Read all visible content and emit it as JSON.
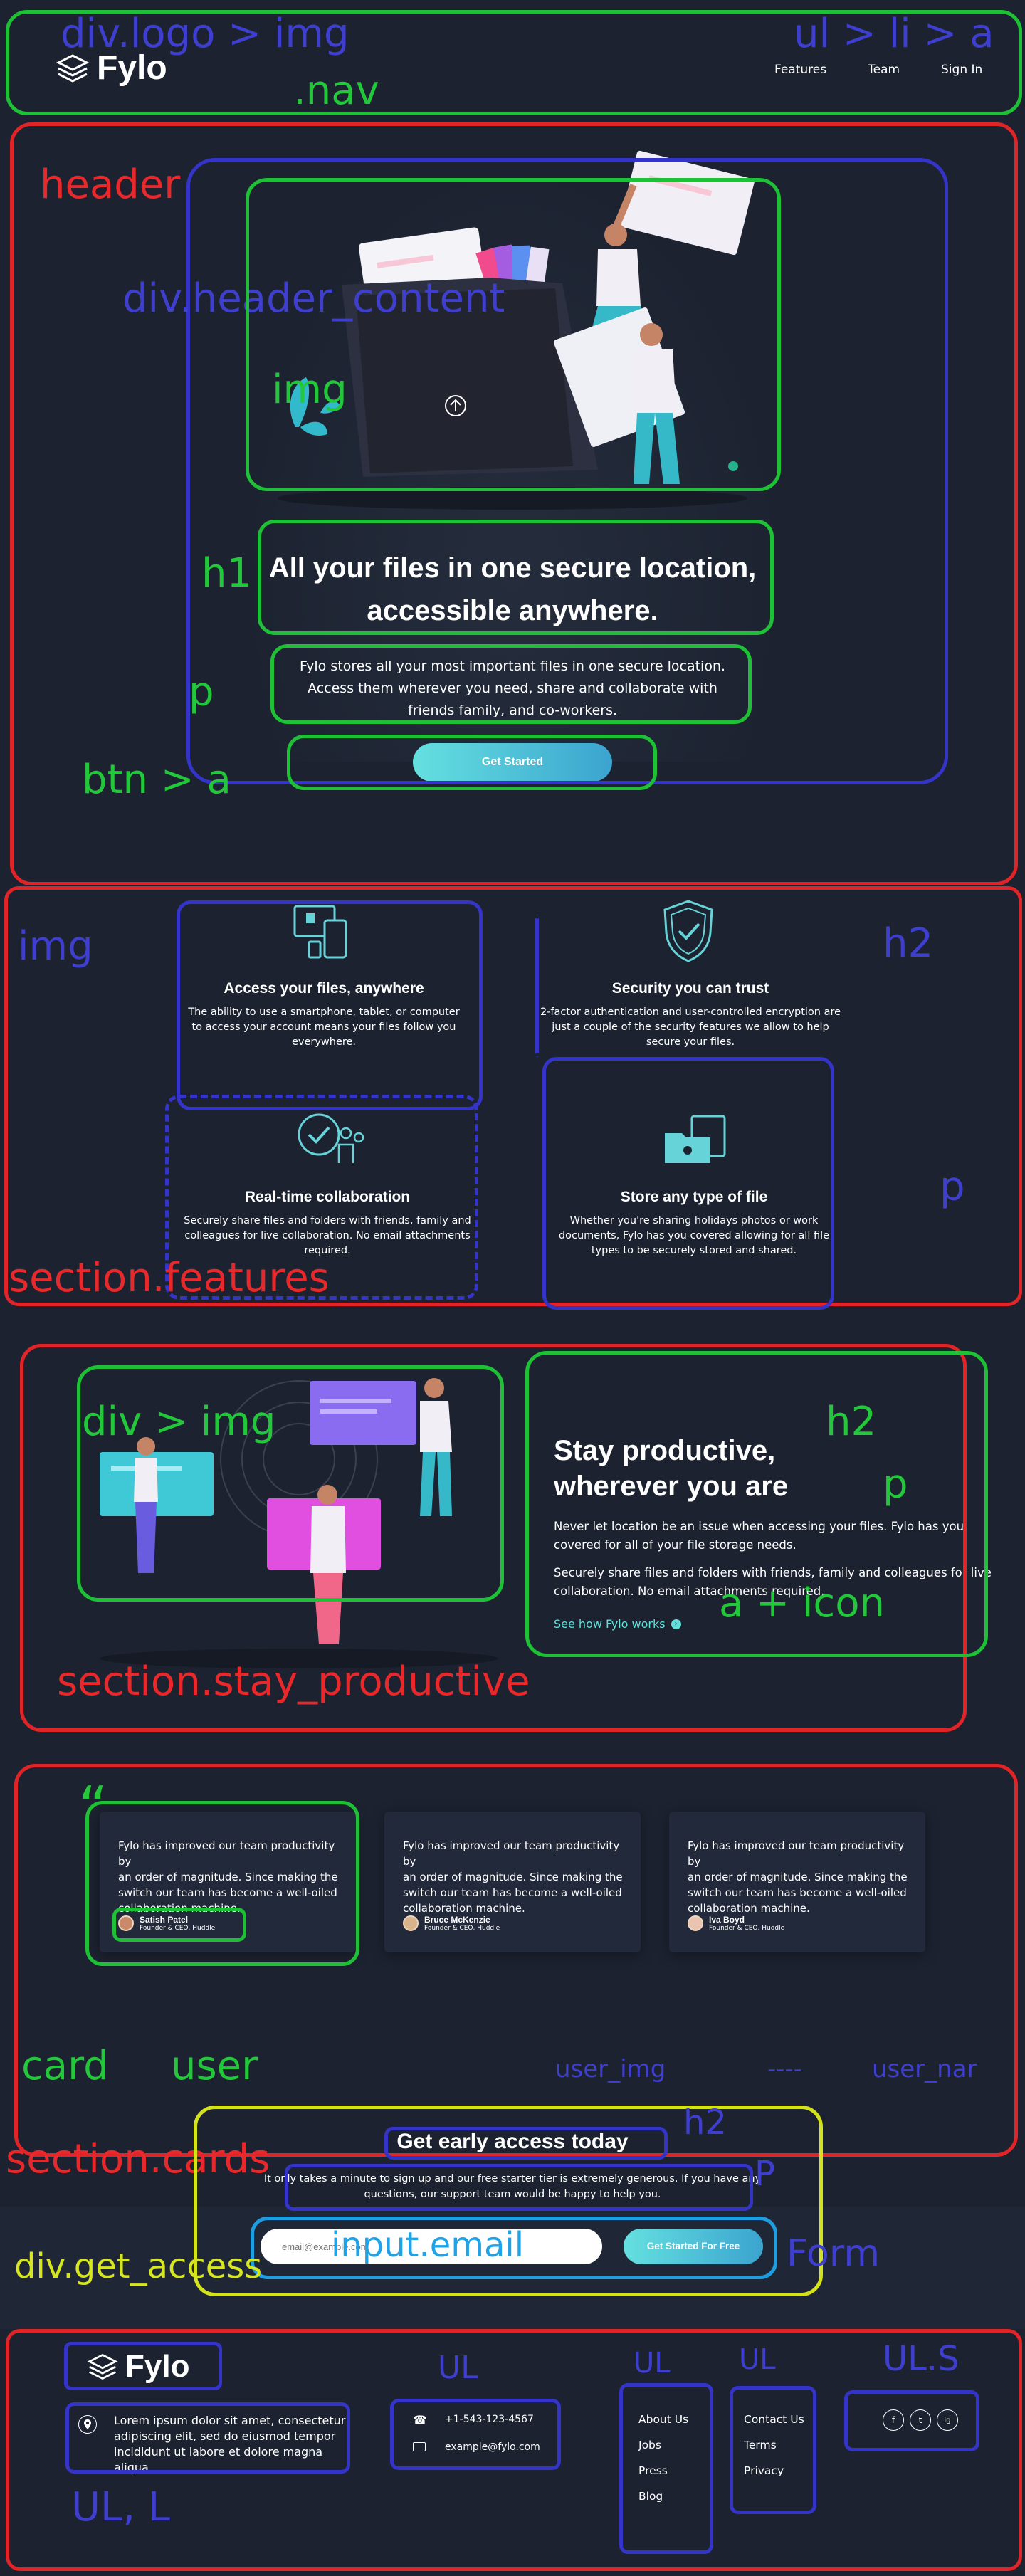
{
  "nav": {
    "brand": "Fylo",
    "links": [
      "Features",
      "Team",
      "Sign In"
    ]
  },
  "hero": {
    "title_line1": "All your files in one secure location,",
    "title_line2": "accessible anywhere.",
    "text_line1": "Fylo stores all your most important files in one secure location.",
    "text_line2": "Access them wherever you need, share and collaborate with",
    "text_line3": "friends family, and co-workers.",
    "button": "Get Started"
  },
  "features": [
    {
      "title": "Access your files, anywhere",
      "lines": [
        "The ability to use a smartphone, tablet, or computer",
        "to access your account means your files follow you",
        "everywhere."
      ],
      "icon": "devices-icon"
    },
    {
      "title": "Security you can trust",
      "lines": [
        "2-factor authentication and user-controlled encryption are",
        "just a couple of the security features we allow to help",
        "secure your files."
      ],
      "icon": "shield-check-icon"
    },
    {
      "title": "Real-time collaboration",
      "lines": [
        "Securely share files and folders with friends, family and",
        "colleagues for live collaboration. No email attachments",
        "required."
      ],
      "icon": "collaboration-icon"
    },
    {
      "title": "Store any type of file",
      "lines": [
        "Whether you're sharing holidays photos or work",
        "documents, Fylo has you covered allowing for all file",
        "types to be securely stored and shared."
      ],
      "icon": "folder-files-icon"
    }
  ],
  "productive": {
    "title_line1": "Stay productive,",
    "title_line2": "wherever you are",
    "p1_line1": "Never let location be an issue when accessing your files. Fylo has you",
    "p1_line2": "covered for all of your file storage needs.",
    "p2_line1": "Securely share files and folders with friends, family and colleagues for live",
    "p2_line2": "collaboration. No email attachments required.",
    "link": "See how Fylo works"
  },
  "testimonials": [
    {
      "lines": [
        "Fylo has improved our team productivity by",
        "an order of magnitude. Since making the",
        "switch our team has become a well-oiled",
        "collaboration machine."
      ],
      "name": "Satish Patel",
      "role": "Founder & CEO, Huddle"
    },
    {
      "lines": [
        "Fylo has improved our team productivity by",
        "an order of magnitude. Since making the",
        "switch our team has become a well-oiled",
        "collaboration machine."
      ],
      "name": "Bruce McKenzie",
      "role": "Founder & CEO, Huddle"
    },
    {
      "lines": [
        "Fylo has improved our team productivity by",
        "an order of magnitude. Since making the",
        "switch our team has become a well-oiled",
        "collaboration machine."
      ],
      "name": "Iva Boyd",
      "role": "Founder & CEO, Huddle"
    }
  ],
  "access": {
    "title": "Get early access today",
    "text_line1": "It only takes a minute to sign up and our free starter tier is extremely generous. If you have any",
    "text_line2": "questions, our support team would be happy to help you.",
    "placeholder": "email@example.com",
    "button": "Get Started For Free"
  },
  "footer": {
    "brand": "Fylo",
    "address_line1": "Lorem ipsum dolor sit amet, consectetur",
    "address_line2": "adipiscing elit, sed do eiusmod tempor",
    "address_line3": "incididunt ut labore et dolore magna aliqua",
    "phone": "+1-543-123-4567",
    "email": "example@fylo.com",
    "links_col1": [
      "About Us",
      "Jobs",
      "Press",
      "Blog"
    ],
    "links_col2": [
      "Contact Us",
      "Terms",
      "Privacy"
    ],
    "social": [
      "f",
      "t",
      "ig"
    ]
  },
  "annotations": {
    "nav_logo": "div.logo > img",
    "nav_links": "ul > li > a",
    "nav": ".nav",
    "header": "header",
    "header_content": "div.header_content",
    "img": "img",
    "h1": "h1",
    "p": "p",
    "btn": "btn > a",
    "feat_img": "img",
    "feat_h2": "h2",
    "feat_p": "p",
    "features": "section.features",
    "div_img": "div > img",
    "prod_h2": "h2",
    "prod_p": "p",
    "prod_a": "a + icon",
    "stay": "section.stay_productive",
    "quote": "“",
    "card": "card",
    "user": "user",
    "user_img": "user_img",
    "dashes": "----",
    "user_name": "user_nar",
    "cards": "section.cards",
    "get_access": "div.get_access",
    "access_h2": "h2",
    "access_p": "P",
    "email": "input.email",
    "form": "Form",
    "ul1": "UL",
    "ul2": "UL",
    "ul3": "UL",
    "uls": "UL.S",
    "ull": "UL, L"
  }
}
